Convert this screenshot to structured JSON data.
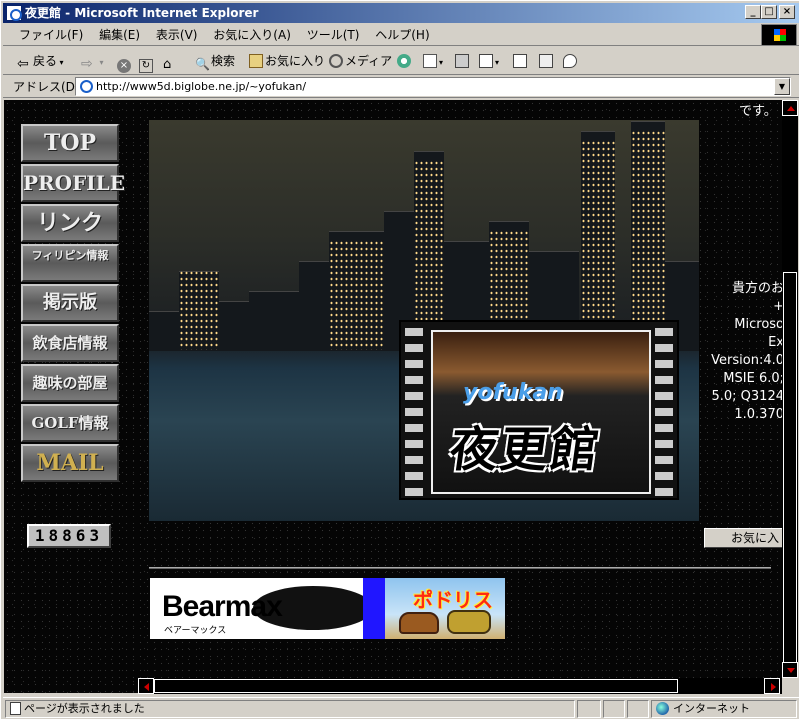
{
  "window": {
    "title": "夜更館 - Microsoft Internet Explorer",
    "controls": {
      "minimize": "_",
      "maximize": "□",
      "close": "×"
    }
  },
  "menubar": {
    "items": [
      "ファイル(F)",
      "編集(E)",
      "表示(V)",
      "お気に入り(A)",
      "ツール(T)",
      "ヘルプ(H)"
    ]
  },
  "toolbar": {
    "back": "戻る",
    "search": "検索",
    "favorites": "お気に入り",
    "media": "メディア"
  },
  "addressbar": {
    "label": "アドレス(D)",
    "url": "http://www5d.biglobe.ne.jp/~yofukan/"
  },
  "page": {
    "nav": [
      "TOP",
      "PROFILE",
      "リンク",
      "フィリピン情報",
      "掲示版",
      "飲食店情報",
      "趣味の部屋",
      "GOLF情報",
      "MAIL"
    ],
    "counter": "18863",
    "top_text": "です。",
    "right_lines": [
      "貴方のお",
      "+",
      "Microso",
      "Ex",
      "Version:4.0",
      "MSIE 6.0;",
      "5.0; Q3124",
      "1.0.370"
    ],
    "fav_button": "お気に入",
    "hero_logo_en": "yofukan",
    "hero_logo_jp": "夜更館",
    "banner1_name": "Bearmax",
    "banner1_sub": "ベアーマックス",
    "banner2_title": "ポドリス"
  },
  "statusbar": {
    "text": "ページが表示されました",
    "zone": "インターネット"
  },
  "colors": {
    "titlebar_start": "#0a246a",
    "titlebar_end": "#a6caf0",
    "chrome": "#d4d0c8",
    "page_bg": "#000000",
    "scroll_arrow": "#cc0000",
    "banner_blue": "#2016ff"
  }
}
